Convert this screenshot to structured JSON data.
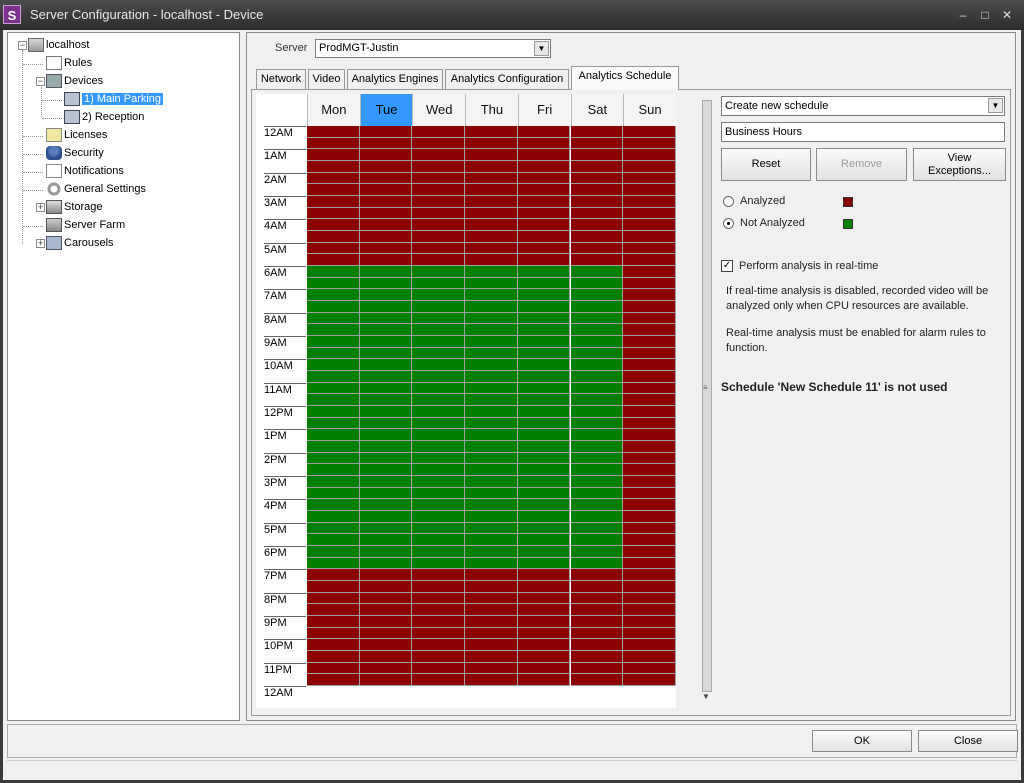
{
  "window": {
    "title": "Server Configuration - localhost - Device",
    "app_icon_letter": "S",
    "minimize": "–",
    "maximize": "□",
    "close": "✕"
  },
  "tree": {
    "root": "localhost",
    "items": [
      {
        "label": "Rules",
        "icon": "rules-icon"
      },
      {
        "label": "Devices",
        "icon": "devices-icon"
      },
      {
        "label": "1) Main Parking",
        "icon": "camera-icon",
        "selected": true
      },
      {
        "label": "2) Reception",
        "icon": "camera-icon"
      },
      {
        "label": "Licenses",
        "icon": "license-icon"
      },
      {
        "label": "Security",
        "icon": "security-icon"
      },
      {
        "label": "Notifications",
        "icon": "notification-icon"
      },
      {
        "label": "General Settings",
        "icon": "gear-icon"
      },
      {
        "label": "Storage",
        "icon": "storage-icon"
      },
      {
        "label": "Server Farm",
        "icon": "server-farm-icon"
      },
      {
        "label": "Carousels",
        "icon": "carousel-icon"
      }
    ]
  },
  "server": {
    "label": "Server",
    "value": "ProdMGT-Justin"
  },
  "tabs": [
    "Network",
    "Video",
    "Analytics Engines",
    "Analytics Configuration",
    "Analytics Schedule"
  ],
  "active_tab": "Analytics Schedule",
  "schedule": {
    "days": [
      "Mon",
      "Tue",
      "Wed",
      "Thu",
      "Fri",
      "Sat",
      "Sun"
    ],
    "highlighted_day": "Tue",
    "hours": [
      "12AM",
      "1AM",
      "2AM",
      "3AM",
      "4AM",
      "5AM",
      "6AM",
      "7AM",
      "8AM",
      "9AM",
      "10AM",
      "11AM",
      "12PM",
      "1PM",
      "2PM",
      "3PM",
      "4PM",
      "5PM",
      "6PM",
      "7PM",
      "8PM",
      "9PM",
      "10PM",
      "11PM",
      "12AM"
    ],
    "slots_per_hour": 2,
    "not_analyzed_start_hour": 6,
    "not_analyzed_end_hour": 19,
    "not_analyzed_days": [
      "Mon",
      "Tue",
      "Wed",
      "Thu",
      "Fri",
      "Sat"
    ],
    "colors": {
      "analyzed": "#8b0000",
      "not_analyzed": "#008000"
    }
  },
  "controls": {
    "schedule_select": "Create new schedule",
    "schedule_name": "Business Hours",
    "reset": "Reset",
    "remove": "Remove",
    "view_exceptions_1": "View",
    "view_exceptions_2": "Exceptions...",
    "analyzed": "Analyzed",
    "not_analyzed": "Not Analyzed",
    "selected_mode": "Not Analyzed",
    "realtime_label": "Perform analysis in real-time",
    "realtime_checked": true,
    "info_1": "If real-time analysis is disabled, recorded video will be analyzed only when CPU resources are available.",
    "info_2": "Real-time analysis must be enabled for alarm rules to function.",
    "status": "Schedule 'New Schedule 11' is not used"
  },
  "footer": {
    "ok": "OK",
    "close": "Close"
  }
}
